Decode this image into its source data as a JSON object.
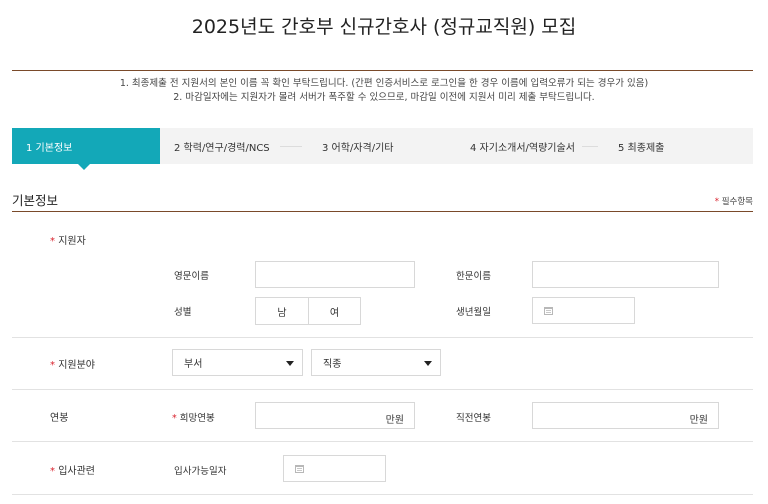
{
  "page": {
    "title": "2025년도 간호부 신규간호사 (정규교직원) 모집"
  },
  "notices": [
    "1. 최종제출 전 지원서의 본인 이름 꼭 확인 부탁드립니다. (간편 인증서비스로 로그인을 한 경우 이름에 입력오류가 되는 경우가 있음)",
    "2. 마감일자에는 지원자가 몰려 서버가 폭주할 수 있으므로, 마감일 이전에 지원서 미리 제출 부탁드립니다."
  ],
  "steps": [
    {
      "label": "1  기본정보",
      "active": true
    },
    {
      "label": "2  학력/연구/경력/NCS",
      "active": false
    },
    {
      "label": "3  어학/자격/기타",
      "active": false
    },
    {
      "label": "4  자기소개서/역량기술서",
      "active": false
    },
    {
      "label": "5  최종제출",
      "active": false
    }
  ],
  "section": {
    "title": "기본정보",
    "required_star": "*",
    "required_note": "필수항목"
  },
  "rows": {
    "applicant": {
      "star": "*",
      "label": "지원자",
      "english_name_label": "영문이름",
      "chinese_name_label": "한문이름",
      "gender_label": "성별",
      "gender_options": [
        "남",
        "여"
      ],
      "birthdate_label": "생년월일"
    },
    "field": {
      "star": "*",
      "label": "지원분야",
      "department": "부서",
      "job": "직종"
    },
    "salary": {
      "label": "연봉",
      "desired_star": "*",
      "desired_label": "희망연봉",
      "desired_unit": "만원",
      "previous_label": "직전연봉",
      "previous_unit": "만원"
    },
    "hire": {
      "star": "*",
      "label": "입사관련",
      "start_date_label": "입사가능일자"
    }
  },
  "colors": {
    "accent": "#13a8b8",
    "rule": "#7a4a2a",
    "required": "#d9232e"
  }
}
